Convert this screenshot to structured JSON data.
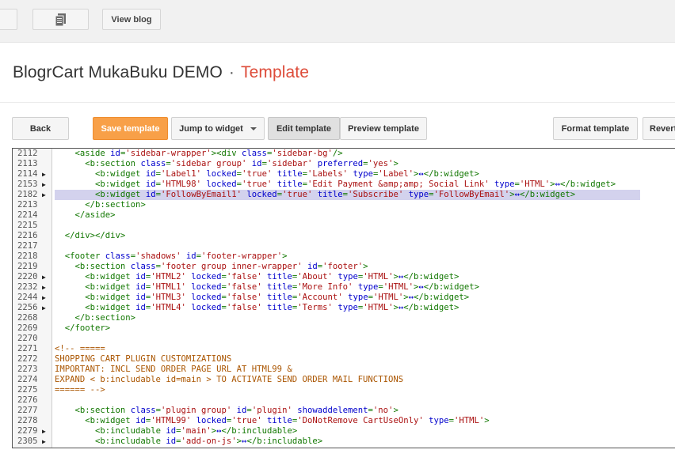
{
  "topbar": {
    "pages_icon": "pages-icon",
    "view_blog": "View blog"
  },
  "header": {
    "blog_name": "BlogrCart MukaBuku DEMO",
    "separator": "·",
    "section": "Template"
  },
  "toolbar": {
    "back": "Back",
    "save": "Save template",
    "jump": "Jump to widget",
    "edit": "Edit template",
    "preview": "Preview template",
    "format": "Format template",
    "revert": "Revert"
  },
  "colors": {
    "accent": "#dd4b39",
    "save_button": "#f8a048",
    "tag": "#117700",
    "attribute": "#0000cc",
    "string": "#aa1111",
    "comment": "#aa5500",
    "highlight": "#d3d2ed"
  },
  "editor": {
    "lines": [
      {
        "n": "2112",
        "fold": false,
        "hl": false,
        "s": [
          [
            "    ",
            ""
          ],
          [
            "<aside ",
            "t"
          ],
          [
            "id",
            "a"
          ],
          [
            "=",
            "t"
          ],
          [
            "'sidebar-wrapper'",
            "v"
          ],
          [
            "><div ",
            "t"
          ],
          [
            "class",
            "a"
          ],
          [
            "=",
            "t"
          ],
          [
            "'sidebar-bg'",
            "v"
          ],
          [
            "/>",
            "t"
          ]
        ]
      },
      {
        "n": "2113",
        "fold": false,
        "hl": false,
        "s": [
          [
            "      ",
            ""
          ],
          [
            "<b:section ",
            "t"
          ],
          [
            "class",
            "a"
          ],
          [
            "=",
            "t"
          ],
          [
            "'sidebar group'",
            "v"
          ],
          [
            " ",
            ""
          ],
          [
            "id",
            "a"
          ],
          [
            "=",
            "t"
          ],
          [
            "'sidebar'",
            "v"
          ],
          [
            " ",
            ""
          ],
          [
            "preferred",
            "a"
          ],
          [
            "=",
            "t"
          ],
          [
            "'yes'",
            "v"
          ],
          [
            ">",
            "t"
          ]
        ]
      },
      {
        "n": "2114",
        "fold": true,
        "hl": false,
        "s": [
          [
            "        ",
            ""
          ],
          [
            "<b:widget ",
            "t"
          ],
          [
            "id",
            "a"
          ],
          [
            "=",
            "t"
          ],
          [
            "'Label1'",
            "v"
          ],
          [
            " ",
            ""
          ],
          [
            "locked",
            "a"
          ],
          [
            "=",
            "t"
          ],
          [
            "'true'",
            "v"
          ],
          [
            " ",
            ""
          ],
          [
            "title",
            "a"
          ],
          [
            "=",
            "t"
          ],
          [
            "'Labels'",
            "v"
          ],
          [
            " ",
            ""
          ],
          [
            "type",
            "a"
          ],
          [
            "=",
            "t"
          ],
          [
            "'Label'",
            "v"
          ],
          [
            ">",
            "t"
          ],
          [
            "↔",
            "f"
          ],
          [
            "</b:widget>",
            "t"
          ]
        ]
      },
      {
        "n": "2153",
        "fold": true,
        "hl": false,
        "s": [
          [
            "        ",
            ""
          ],
          [
            "<b:widget ",
            "t"
          ],
          [
            "id",
            "a"
          ],
          [
            "=",
            "t"
          ],
          [
            "'HTML98'",
            "v"
          ],
          [
            " ",
            ""
          ],
          [
            "locked",
            "a"
          ],
          [
            "=",
            "t"
          ],
          [
            "'true'",
            "v"
          ],
          [
            " ",
            ""
          ],
          [
            "title",
            "a"
          ],
          [
            "=",
            "t"
          ],
          [
            "'Edit Payment &amp;amp; Social Link'",
            "v"
          ],
          [
            " ",
            ""
          ],
          [
            "type",
            "a"
          ],
          [
            "=",
            "t"
          ],
          [
            "'HTML'",
            "v"
          ],
          [
            ">",
            "t"
          ],
          [
            "↔",
            "f"
          ],
          [
            "</b:widget>",
            "t"
          ]
        ]
      },
      {
        "n": "2182",
        "fold": true,
        "hl": true,
        "s": [
          [
            "        ",
            ""
          ],
          [
            "<b:widget ",
            "t"
          ],
          [
            "id",
            "a"
          ],
          [
            "=",
            "t"
          ],
          [
            "'FollowByEmail1'",
            "v"
          ],
          [
            " ",
            ""
          ],
          [
            "locked",
            "a"
          ],
          [
            "=",
            "t"
          ],
          [
            "'true'",
            "v"
          ],
          [
            " ",
            ""
          ],
          [
            "title",
            "a"
          ],
          [
            "=",
            "t"
          ],
          [
            "'Subscribe'",
            "v"
          ],
          [
            " ",
            ""
          ],
          [
            "type",
            "a"
          ],
          [
            "=",
            "t"
          ],
          [
            "'FollowByEmail'",
            "v"
          ],
          [
            ">",
            "t"
          ],
          [
            "↔",
            "f"
          ],
          [
            "</b:widget>",
            "t"
          ]
        ]
      },
      {
        "n": "2213",
        "fold": false,
        "hl": false,
        "s": [
          [
            "      ",
            ""
          ],
          [
            "</b:section>",
            "t"
          ]
        ]
      },
      {
        "n": "2214",
        "fold": false,
        "hl": false,
        "s": [
          [
            "    ",
            ""
          ],
          [
            "</aside>",
            "t"
          ]
        ]
      },
      {
        "n": "2215",
        "fold": false,
        "hl": false,
        "s": []
      },
      {
        "n": "2216",
        "fold": false,
        "hl": false,
        "s": [
          [
            "  ",
            ""
          ],
          [
            "</div></div>",
            "t"
          ]
        ]
      },
      {
        "n": "2217",
        "fold": false,
        "hl": false,
        "s": []
      },
      {
        "n": "2218",
        "fold": false,
        "hl": false,
        "s": [
          [
            "  ",
            ""
          ],
          [
            "<footer ",
            "t"
          ],
          [
            "class",
            "a"
          ],
          [
            "=",
            "t"
          ],
          [
            "'shadows'",
            "v"
          ],
          [
            " ",
            ""
          ],
          [
            "id",
            "a"
          ],
          [
            "=",
            "t"
          ],
          [
            "'footer-wrapper'",
            "v"
          ],
          [
            ">",
            "t"
          ]
        ]
      },
      {
        "n": "2219",
        "fold": false,
        "hl": false,
        "s": [
          [
            "    ",
            ""
          ],
          [
            "<b:section ",
            "t"
          ],
          [
            "class",
            "a"
          ],
          [
            "=",
            "t"
          ],
          [
            "'footer group inner-wrapper'",
            "v"
          ],
          [
            " ",
            ""
          ],
          [
            "id",
            "a"
          ],
          [
            "=",
            "t"
          ],
          [
            "'footer'",
            "v"
          ],
          [
            ">",
            "t"
          ]
        ]
      },
      {
        "n": "2220",
        "fold": true,
        "hl": false,
        "s": [
          [
            "      ",
            ""
          ],
          [
            "<b:widget ",
            "t"
          ],
          [
            "id",
            "a"
          ],
          [
            "=",
            "t"
          ],
          [
            "'HTML2'",
            "v"
          ],
          [
            " ",
            ""
          ],
          [
            "locked",
            "a"
          ],
          [
            "=",
            "t"
          ],
          [
            "'false'",
            "v"
          ],
          [
            " ",
            ""
          ],
          [
            "title",
            "a"
          ],
          [
            "=",
            "t"
          ],
          [
            "'About'",
            "v"
          ],
          [
            " ",
            ""
          ],
          [
            "type",
            "a"
          ],
          [
            "=",
            "t"
          ],
          [
            "'HTML'",
            "v"
          ],
          [
            ">",
            "t"
          ],
          [
            "↔",
            "f"
          ],
          [
            "</b:widget>",
            "t"
          ]
        ]
      },
      {
        "n": "2232",
        "fold": true,
        "hl": false,
        "s": [
          [
            "      ",
            ""
          ],
          [
            "<b:widget ",
            "t"
          ],
          [
            "id",
            "a"
          ],
          [
            "=",
            "t"
          ],
          [
            "'HTML1'",
            "v"
          ],
          [
            " ",
            ""
          ],
          [
            "locked",
            "a"
          ],
          [
            "=",
            "t"
          ],
          [
            "'false'",
            "v"
          ],
          [
            " ",
            ""
          ],
          [
            "title",
            "a"
          ],
          [
            "=",
            "t"
          ],
          [
            "'More Info'",
            "v"
          ],
          [
            " ",
            ""
          ],
          [
            "type",
            "a"
          ],
          [
            "=",
            "t"
          ],
          [
            "'HTML'",
            "v"
          ],
          [
            ">",
            "t"
          ],
          [
            "↔",
            "f"
          ],
          [
            "</b:widget>",
            "t"
          ]
        ]
      },
      {
        "n": "2244",
        "fold": true,
        "hl": false,
        "s": [
          [
            "      ",
            ""
          ],
          [
            "<b:widget ",
            "t"
          ],
          [
            "id",
            "a"
          ],
          [
            "=",
            "t"
          ],
          [
            "'HTML3'",
            "v"
          ],
          [
            " ",
            ""
          ],
          [
            "locked",
            "a"
          ],
          [
            "=",
            "t"
          ],
          [
            "'false'",
            "v"
          ],
          [
            " ",
            ""
          ],
          [
            "title",
            "a"
          ],
          [
            "=",
            "t"
          ],
          [
            "'Account'",
            "v"
          ],
          [
            " ",
            ""
          ],
          [
            "type",
            "a"
          ],
          [
            "=",
            "t"
          ],
          [
            "'HTML'",
            "v"
          ],
          [
            ">",
            "t"
          ],
          [
            "↔",
            "f"
          ],
          [
            "</b:widget>",
            "t"
          ]
        ]
      },
      {
        "n": "2256",
        "fold": true,
        "hl": false,
        "s": [
          [
            "      ",
            ""
          ],
          [
            "<b:widget ",
            "t"
          ],
          [
            "id",
            "a"
          ],
          [
            "=",
            "t"
          ],
          [
            "'HTML4'",
            "v"
          ],
          [
            " ",
            ""
          ],
          [
            "locked",
            "a"
          ],
          [
            "=",
            "t"
          ],
          [
            "'false'",
            "v"
          ],
          [
            " ",
            ""
          ],
          [
            "title",
            "a"
          ],
          [
            "=",
            "t"
          ],
          [
            "'Terms'",
            "v"
          ],
          [
            " ",
            ""
          ],
          [
            "type",
            "a"
          ],
          [
            "=",
            "t"
          ],
          [
            "'HTML'",
            "v"
          ],
          [
            ">",
            "t"
          ],
          [
            "↔",
            "f"
          ],
          [
            "</b:widget>",
            "t"
          ]
        ]
      },
      {
        "n": "2268",
        "fold": false,
        "hl": false,
        "s": [
          [
            "    ",
            ""
          ],
          [
            "</b:section>",
            "t"
          ]
        ]
      },
      {
        "n": "2269",
        "fold": false,
        "hl": false,
        "s": [
          [
            "  ",
            ""
          ],
          [
            "</footer>",
            "t"
          ]
        ]
      },
      {
        "n": "2270",
        "fold": false,
        "hl": false,
        "s": []
      },
      {
        "n": "2271",
        "fold": false,
        "hl": false,
        "s": [
          [
            "<!-- =====",
            "c"
          ]
        ]
      },
      {
        "n": "2272",
        "fold": false,
        "hl": false,
        "s": [
          [
            "SHOPPING CART PLUGIN CUSTOMIZATIONS",
            "c"
          ]
        ]
      },
      {
        "n": "2273",
        "fold": false,
        "hl": false,
        "s": [
          [
            "IMPORTANT: INCL SEND ORDER PAGE URL AT HTML99 &",
            "c"
          ]
        ]
      },
      {
        "n": "2274",
        "fold": false,
        "hl": false,
        "s": [
          [
            "EXPAND < b:includable id=main > TO ACTIVATE SEND ORDER MAIL FUNCTIONS",
            "c"
          ]
        ]
      },
      {
        "n": "2275",
        "fold": false,
        "hl": false,
        "s": [
          [
            "====== -->",
            "c"
          ]
        ]
      },
      {
        "n": "2276",
        "fold": false,
        "hl": false,
        "s": []
      },
      {
        "n": "2277",
        "fold": false,
        "hl": false,
        "s": [
          [
            "    ",
            ""
          ],
          [
            "<b:section ",
            "t"
          ],
          [
            "class",
            "a"
          ],
          [
            "=",
            "t"
          ],
          [
            "'plugin group'",
            "v"
          ],
          [
            " ",
            ""
          ],
          [
            "id",
            "a"
          ],
          [
            "=",
            "t"
          ],
          [
            "'plugin'",
            "v"
          ],
          [
            " ",
            ""
          ],
          [
            "showaddelement",
            "a"
          ],
          [
            "=",
            "t"
          ],
          [
            "'no'",
            "v"
          ],
          [
            ">",
            "t"
          ]
        ]
      },
      {
        "n": "2278",
        "fold": false,
        "hl": false,
        "s": [
          [
            "      ",
            ""
          ],
          [
            "<b:widget ",
            "t"
          ],
          [
            "id",
            "a"
          ],
          [
            "=",
            "t"
          ],
          [
            "'HTML99'",
            "v"
          ],
          [
            " ",
            ""
          ],
          [
            "locked",
            "a"
          ],
          [
            "=",
            "t"
          ],
          [
            "'true'",
            "v"
          ],
          [
            " ",
            ""
          ],
          [
            "title",
            "a"
          ],
          [
            "=",
            "t"
          ],
          [
            "'DoNotRemove CartUseOnly'",
            "v"
          ],
          [
            " ",
            ""
          ],
          [
            "type",
            "a"
          ],
          [
            "=",
            "t"
          ],
          [
            "'HTML'",
            "v"
          ],
          [
            ">",
            "t"
          ]
        ]
      },
      {
        "n": "2279",
        "fold": true,
        "hl": false,
        "s": [
          [
            "        ",
            ""
          ],
          [
            "<b:includable ",
            "t"
          ],
          [
            "id",
            "a"
          ],
          [
            "=",
            "t"
          ],
          [
            "'main'",
            "v"
          ],
          [
            ">",
            "t"
          ],
          [
            "↔",
            "f"
          ],
          [
            "</b:includable>",
            "t"
          ]
        ]
      },
      {
        "n": "2305",
        "fold": true,
        "hl": false,
        "s": [
          [
            "        ",
            ""
          ],
          [
            "<b:includable ",
            "t"
          ],
          [
            "id",
            "a"
          ],
          [
            "=",
            "t"
          ],
          [
            "'add-on-js'",
            "v"
          ],
          [
            ">",
            "t"
          ],
          [
            "↔",
            "f"
          ],
          [
            "</b:includable>",
            "t"
          ]
        ]
      }
    ]
  }
}
